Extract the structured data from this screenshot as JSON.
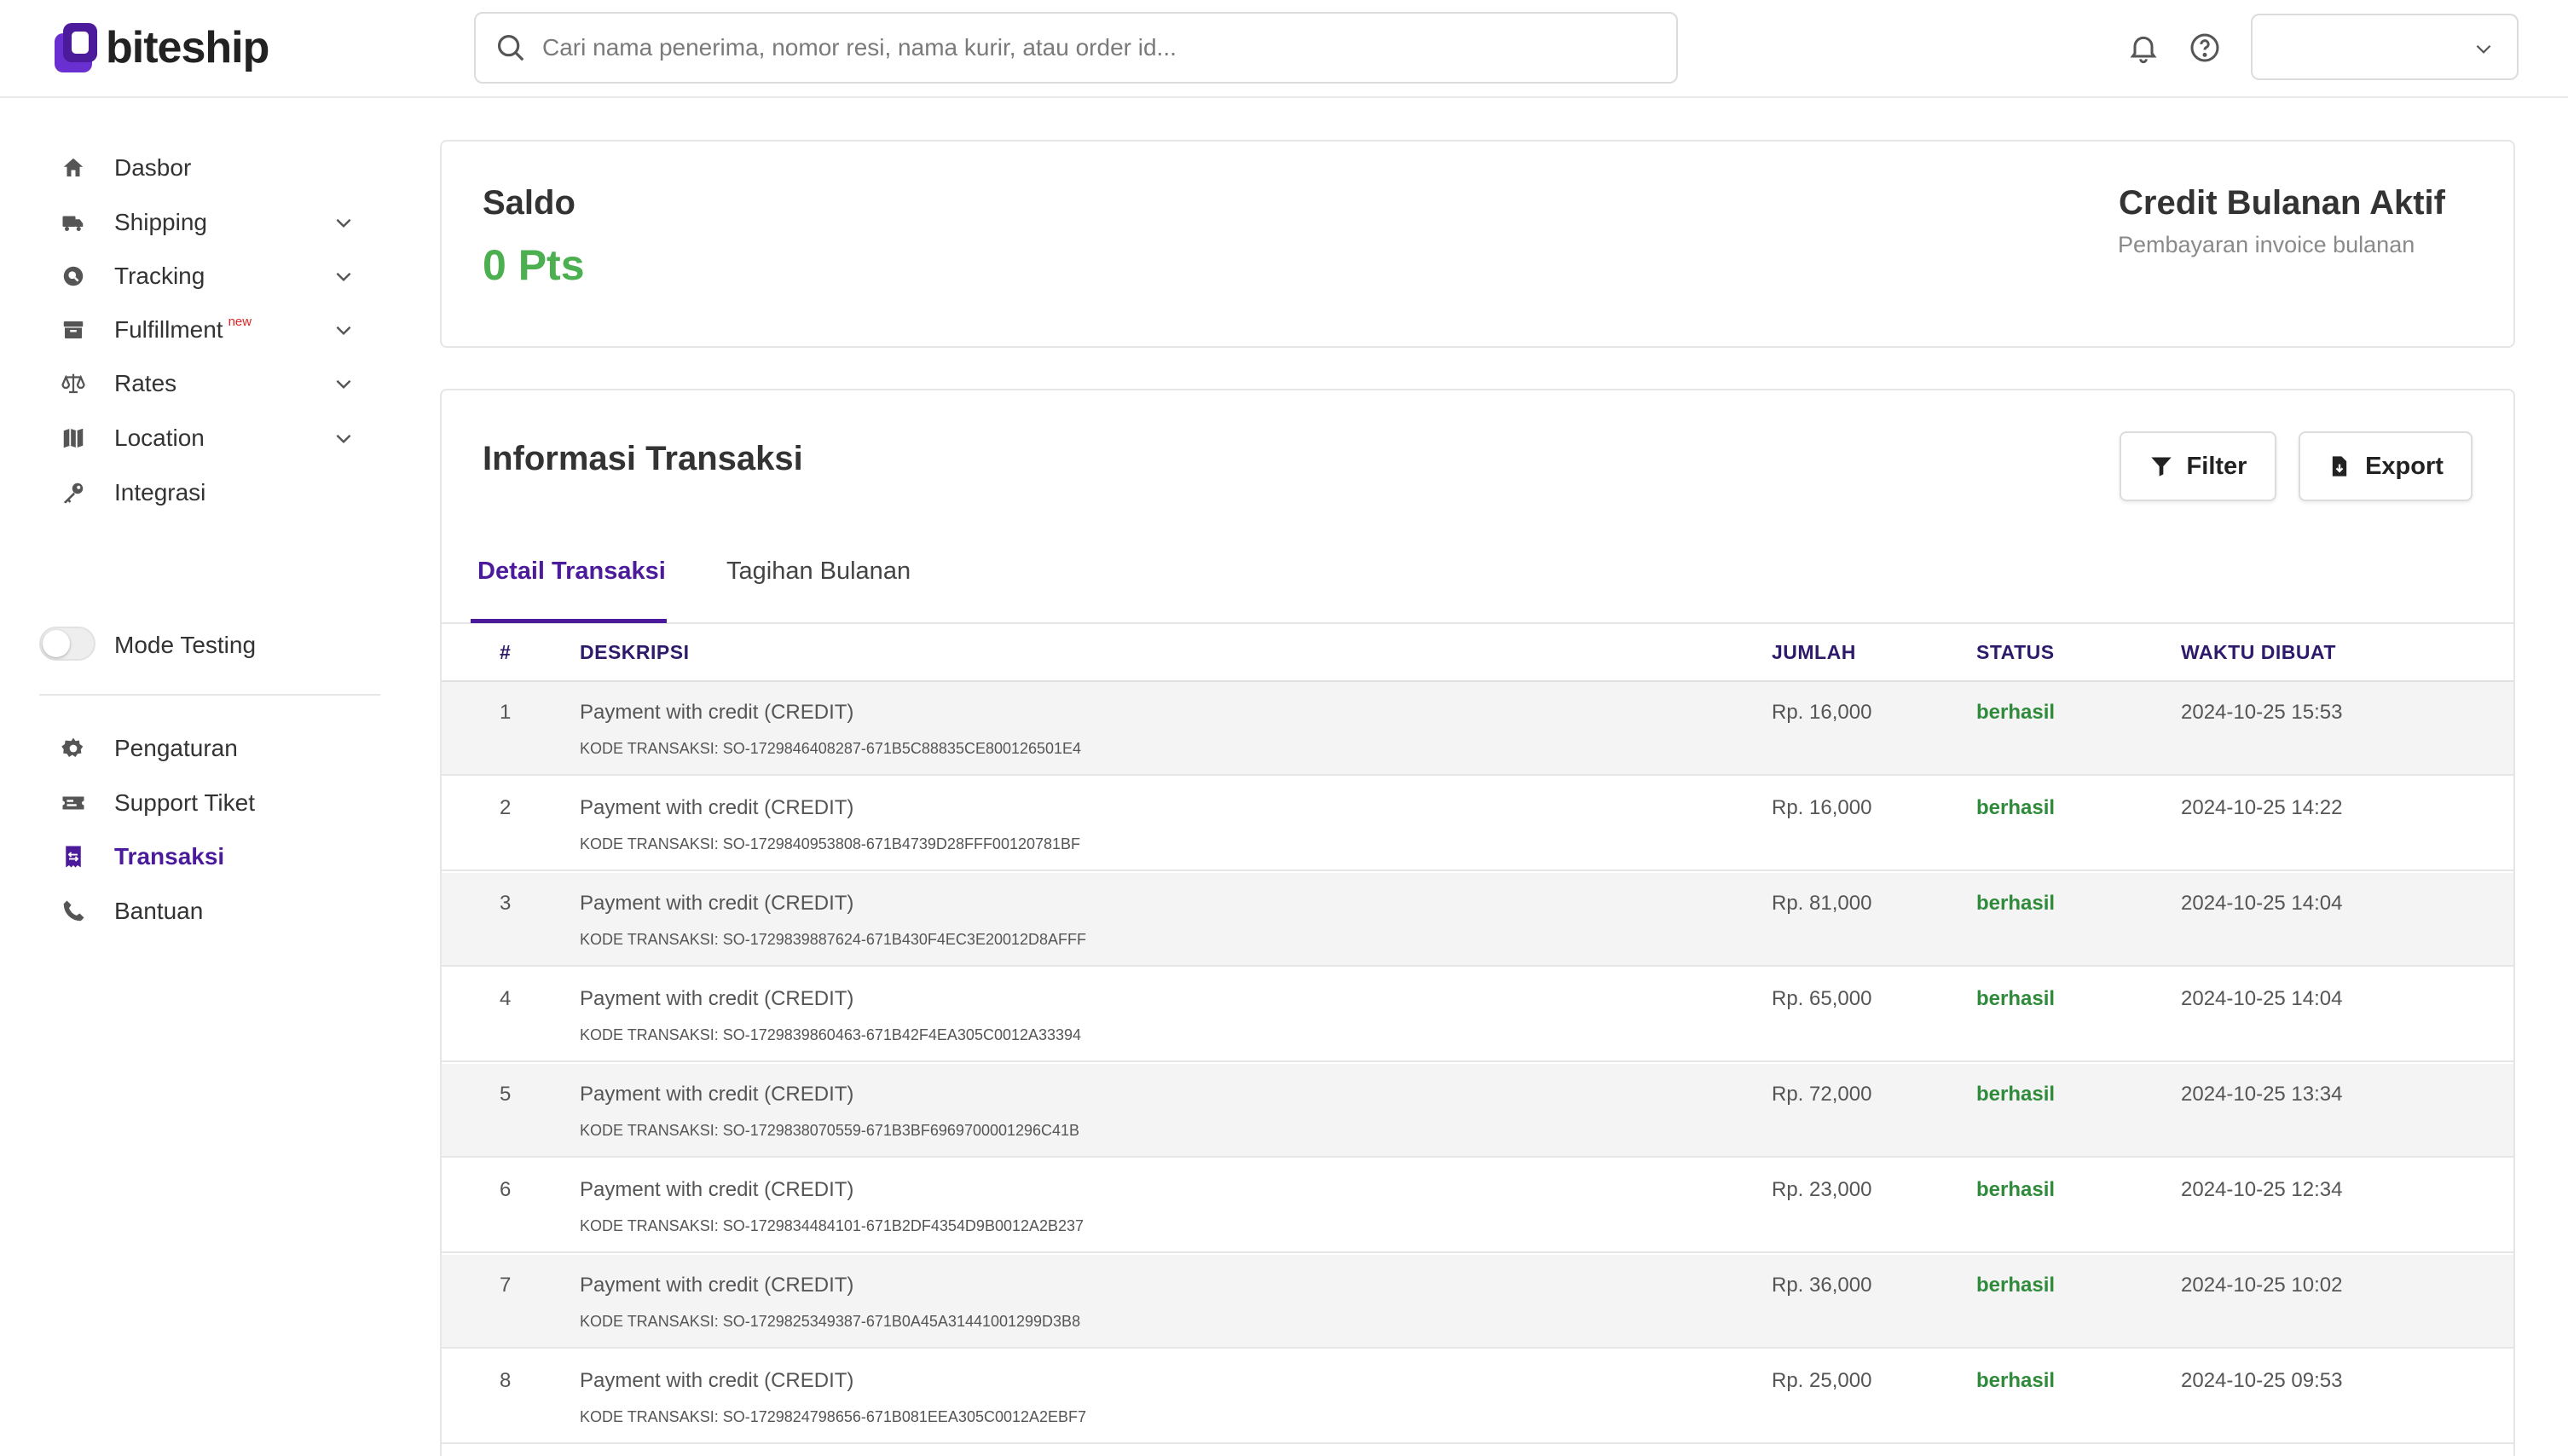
{
  "brand": {
    "name": "biteship"
  },
  "search": {
    "placeholder": "Cari nama penerima, nomor resi, nama kurir, atau order id..."
  },
  "sidebar": {
    "items": [
      {
        "label": "Dasbor",
        "icon": "home-icon"
      },
      {
        "label": "Shipping",
        "icon": "truck-icon"
      },
      {
        "label": "Tracking",
        "icon": "tracking-icon"
      },
      {
        "label": "Fulfillment",
        "icon": "archive-icon",
        "badge": "new"
      },
      {
        "label": "Rates",
        "icon": "scale-icon"
      },
      {
        "label": "Location",
        "icon": "map-icon"
      },
      {
        "label": "Integrasi",
        "icon": "key-icon"
      }
    ],
    "mode_testing_label": "Mode Testing",
    "bottom_items": [
      {
        "label": "Pengaturan",
        "icon": "gear-icon"
      },
      {
        "label": "Support Tiket",
        "icon": "ticket-icon"
      },
      {
        "label": "Transaksi",
        "icon": "transaction-icon",
        "active": true
      },
      {
        "label": "Bantuan",
        "icon": "phone-icon"
      }
    ]
  },
  "saldo": {
    "title": "Saldo",
    "value": "0 Pts",
    "credit_title": "Credit Bulanan Aktif",
    "credit_subtitle": "Pembayaran invoice bulanan"
  },
  "transactions": {
    "title": "Informasi Transaksi",
    "filter_label": "Filter",
    "export_label": "Export",
    "tabs": [
      "Detail Transaksi",
      "Tagihan Bulanan"
    ],
    "columns": [
      "#",
      "DESKRIPSI",
      "JUMLAH",
      "STATUS",
      "WAKTU DIBUAT"
    ],
    "rows": [
      {
        "no": "1",
        "desc": "Payment with credit (CREDIT)",
        "code": "KODE TRANSAKSI: SO-1729846408287-671B5C88835CE800126501E4",
        "amount": "Rp. 16,000",
        "status": "berhasil",
        "time": "2024-10-25 15:53"
      },
      {
        "no": "2",
        "desc": "Payment with credit (CREDIT)",
        "code": "KODE TRANSAKSI: SO-1729840953808-671B4739D28FFF00120781BF",
        "amount": "Rp. 16,000",
        "status": "berhasil",
        "time": "2024-10-25 14:22"
      },
      {
        "no": "3",
        "desc": "Payment with credit (CREDIT)",
        "code": "KODE TRANSAKSI: SO-1729839887624-671B430F4EC3E20012D8AFFF",
        "amount": "Rp. 81,000",
        "status": "berhasil",
        "time": "2024-10-25 14:04"
      },
      {
        "no": "4",
        "desc": "Payment with credit (CREDIT)",
        "code": "KODE TRANSAKSI: SO-1729839860463-671B42F4EA305C0012A33394",
        "amount": "Rp. 65,000",
        "status": "berhasil",
        "time": "2024-10-25 14:04"
      },
      {
        "no": "5",
        "desc": "Payment with credit (CREDIT)",
        "code": "KODE TRANSAKSI: SO-1729838070559-671B3BF6969700001296C41B",
        "amount": "Rp. 72,000",
        "status": "berhasil",
        "time": "2024-10-25 13:34"
      },
      {
        "no": "6",
        "desc": "Payment with credit (CREDIT)",
        "code": "KODE TRANSAKSI: SO-1729834484101-671B2DF4354D9B0012A2B237",
        "amount": "Rp. 23,000",
        "status": "berhasil",
        "time": "2024-10-25 12:34"
      },
      {
        "no": "7",
        "desc": "Payment with credit (CREDIT)",
        "code": "KODE TRANSAKSI: SO-1729825349387-671B0A45A31441001299D3B8",
        "amount": "Rp. 36,000",
        "status": "berhasil",
        "time": "2024-10-25 10:02"
      },
      {
        "no": "8",
        "desc": "Payment with credit (CREDIT)",
        "code": "KODE TRANSAKSI: SO-1729824798656-671B081EEA305C0012A2EBF7",
        "amount": "Rp. 25,000",
        "status": "berhasil",
        "time": "2024-10-25 09:53"
      }
    ]
  },
  "colors": {
    "accent": "#4b1b9c",
    "success": "#2e8b3a",
    "saldo": "#4caf50"
  }
}
